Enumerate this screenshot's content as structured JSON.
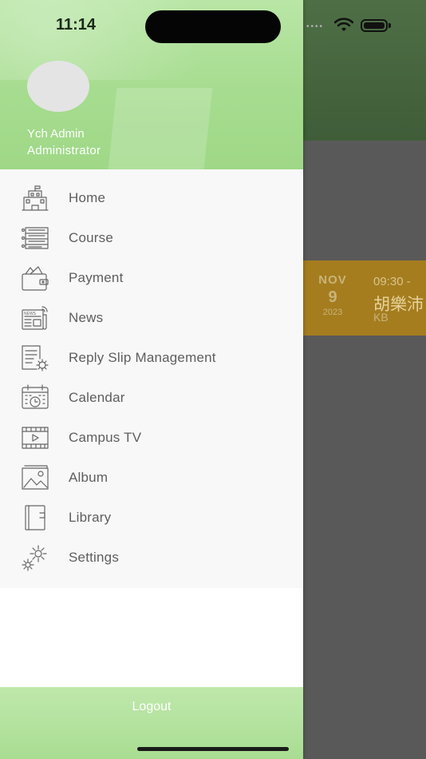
{
  "status_bar": {
    "time": "11:14"
  },
  "background_event": {
    "month": "NOV",
    "day": "9",
    "year": "2023",
    "time": "09:30 -",
    "title": "胡樂沛",
    "location": "KB"
  },
  "user": {
    "name": "Ych Admin",
    "role": "Administrator"
  },
  "menu": {
    "items": [
      {
        "label": "Home",
        "icon": "school-building-icon"
      },
      {
        "label": "Course",
        "icon": "course-list-icon"
      },
      {
        "label": "Payment",
        "icon": "wallet-icon"
      },
      {
        "label": "News",
        "icon": "newspaper-icon"
      },
      {
        "label": "Reply Slip Management",
        "icon": "document-gear-icon"
      },
      {
        "label": "Calendar",
        "icon": "calendar-clock-icon"
      },
      {
        "label": "Campus TV",
        "icon": "video-play-icon"
      },
      {
        "label": "Album",
        "icon": "picture-icon"
      },
      {
        "label": "Library",
        "icon": "book-icon"
      },
      {
        "label": "Settings",
        "icon": "gear-icon"
      }
    ]
  },
  "footer": {
    "logout_label": "Logout"
  },
  "colors": {
    "header_green": "#a6dc8f",
    "event_card": "#a57d1f",
    "overlay": "#595959"
  }
}
